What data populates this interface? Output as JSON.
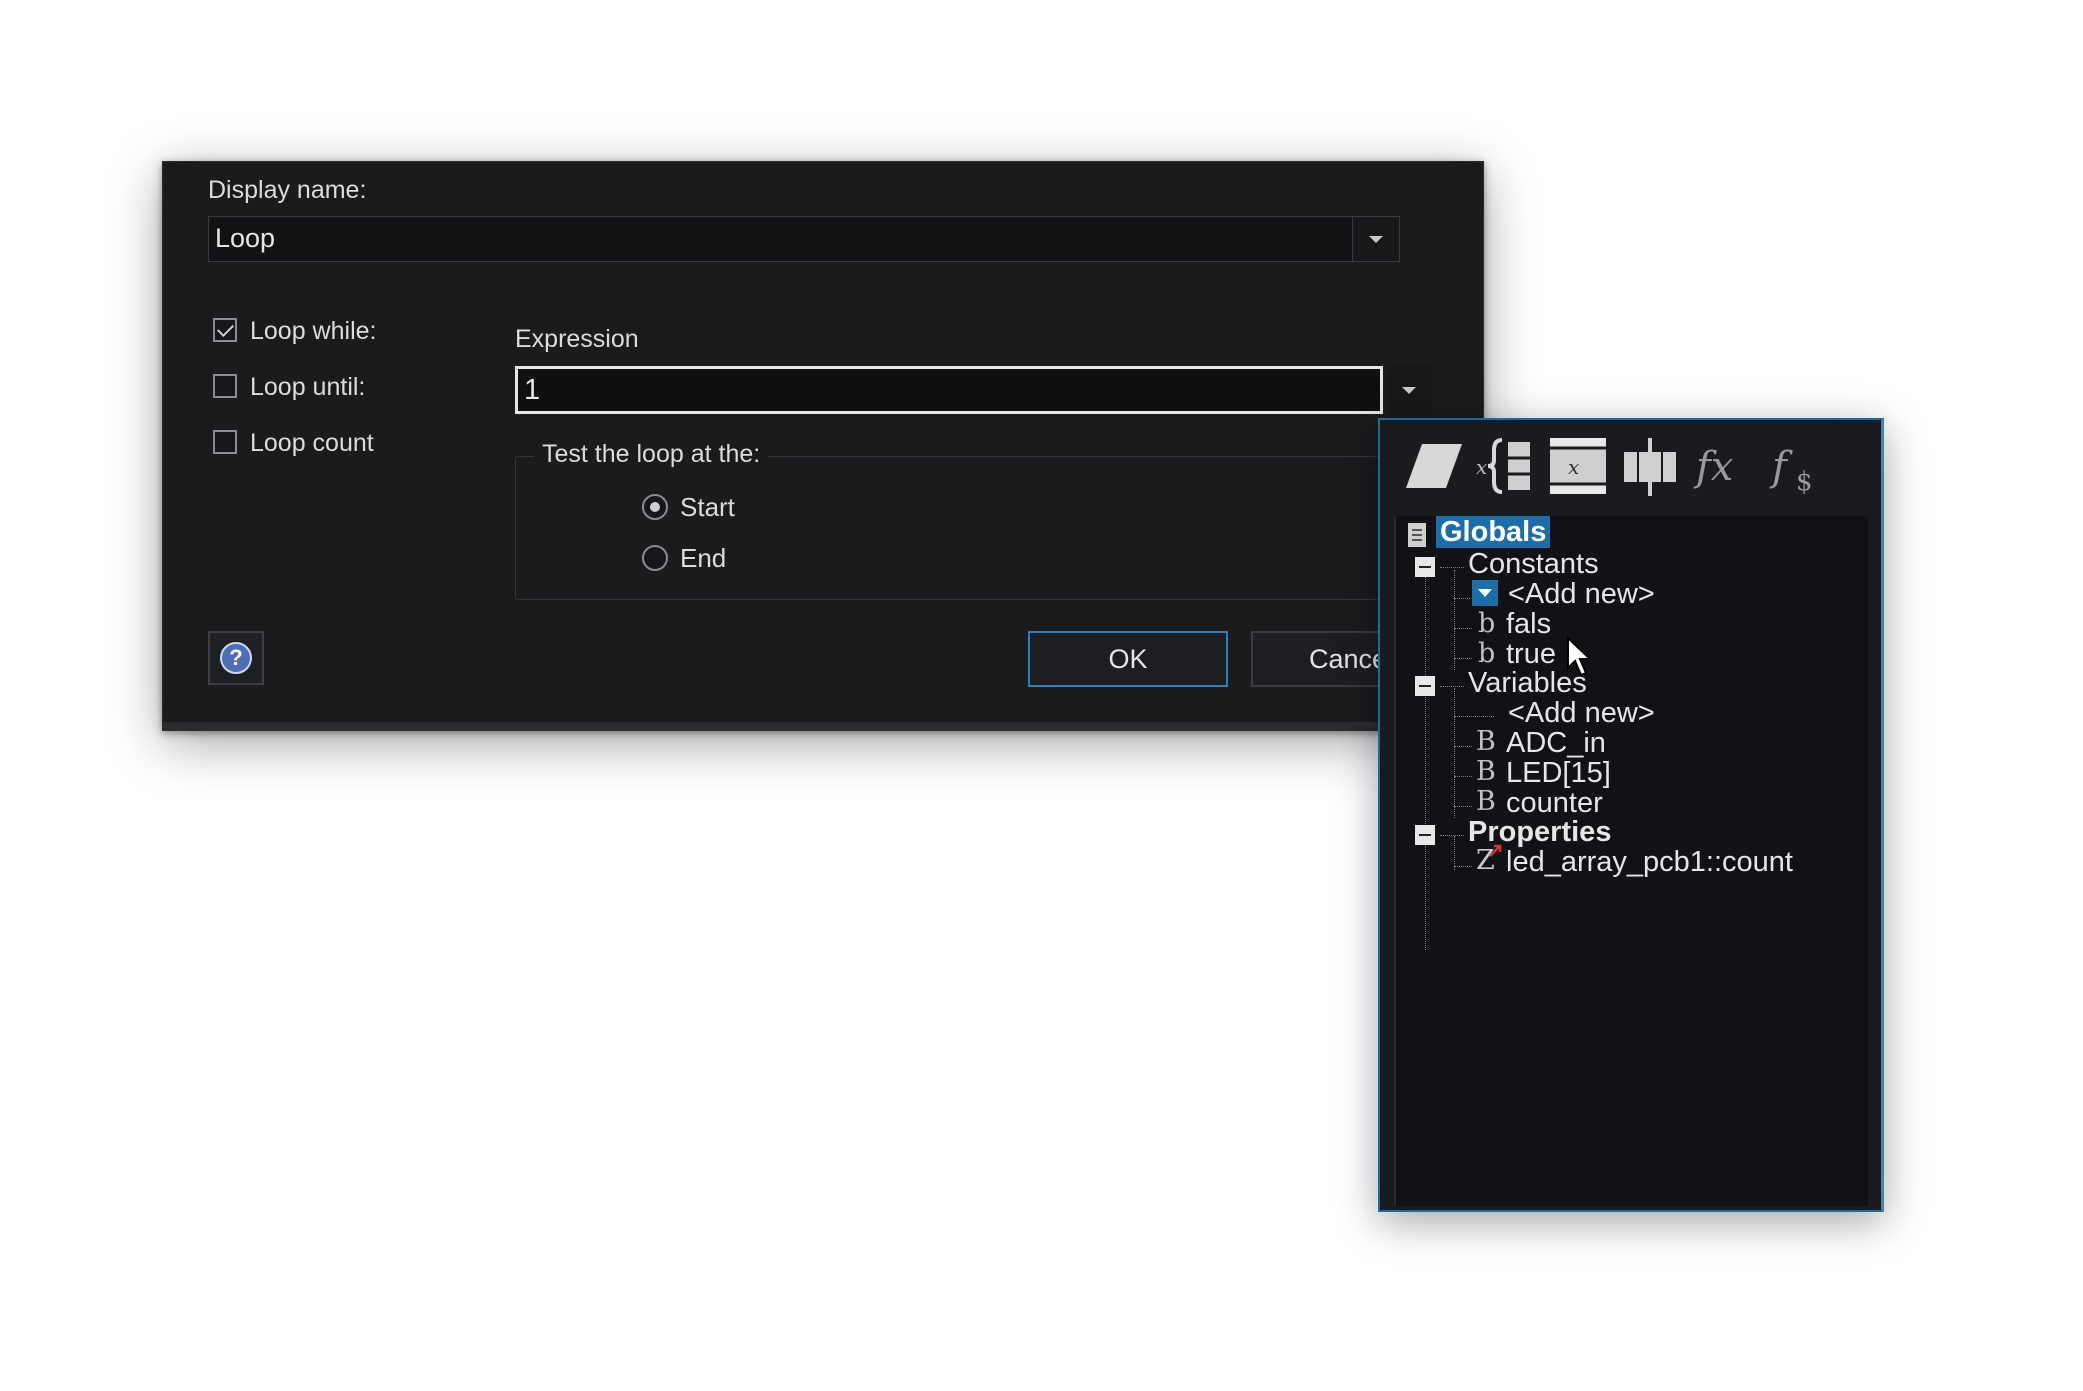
{
  "dialog": {
    "display_name_label": "Display name:",
    "display_name_value": "Loop",
    "loop_while": {
      "label": "Loop while:",
      "checked": true
    },
    "loop_until": {
      "label": "Loop until:",
      "checked": false
    },
    "loop_count": {
      "label": "Loop count",
      "checked": false
    },
    "expression_label": "Expression",
    "expression_value": "1",
    "test_group": {
      "title": "Test the loop at the:",
      "options": [
        {
          "label": "Start",
          "selected": true
        },
        {
          "label": "End",
          "selected": false
        }
      ]
    },
    "ok_label": "OK",
    "cancel_label": "Cance"
  },
  "globals_panel": {
    "toolbar_icons": [
      "parallelogram-icon",
      "variable-brace-icon",
      "array-x-icon",
      "component-icon",
      "fx-icon",
      "fs-icon"
    ],
    "root": "Globals",
    "constants": {
      "label": "Constants",
      "add_new": "<Add new>",
      "items": [
        {
          "type_icon": "b",
          "name": "fals"
        },
        {
          "type_icon": "b",
          "name": "true"
        }
      ]
    },
    "variables": {
      "label": "Variables",
      "add_new": "<Add new>",
      "items": [
        {
          "type_icon": "B",
          "name": "ADC_in"
        },
        {
          "type_icon": "B",
          "name": "LED[15]"
        },
        {
          "type_icon": "B",
          "name": "counter"
        }
      ]
    },
    "properties": {
      "label": "Properties",
      "items": [
        {
          "type_icon": "Z",
          "name": "led_array_pcb1::count"
        }
      ]
    }
  },
  "colors": {
    "dialog_bg": "#1a1b1d",
    "accent": "#1d6ea8",
    "ok_border": "#2f7fc0",
    "panel_border": "#1e6a9c"
  }
}
